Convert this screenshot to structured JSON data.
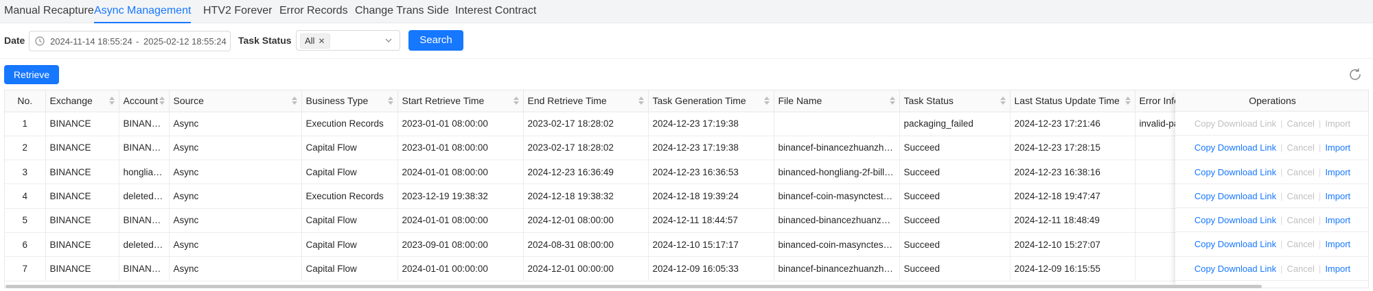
{
  "tabs": [
    {
      "label": "Manual Recapture"
    },
    {
      "label": "Async Management"
    },
    {
      "label": "HTV2 Forever"
    },
    {
      "label": "Error Records"
    },
    {
      "label": "Change Trans Side"
    },
    {
      "label": "Interest Contract"
    }
  ],
  "active_tab": "Async Management",
  "filters": {
    "date_label": "Date",
    "date_start": "2024-11-14 18:55:24",
    "date_sep": "-",
    "date_end": "2025-02-12 18:55:24",
    "task_status_label": "Task Status",
    "task_status_tag": "All",
    "search_label": "Search"
  },
  "toolbar": {
    "retrieve_label": "Retrieve"
  },
  "table": {
    "columns": [
      "No.",
      "Exchange",
      "Account",
      "Source",
      "Business Type",
      "Start Retrieve Time",
      "End Retrieve Time",
      "Task Generation Time",
      "File Name",
      "Task Status",
      "Last Status Update Time",
      "Error Info",
      "Operations"
    ],
    "rows": [
      {
        "no": "1",
        "exchange": "BINANCE",
        "account": "BINANC...",
        "source": "Async",
        "business_type": "Execution Records",
        "start": "2023-01-01 08:00:00",
        "end": "2023-02-17 18:28:02",
        "generated": "2024-12-23 17:19:38",
        "file": "",
        "status": "packaging_failed",
        "updated": "2024-12-23 17:21:46",
        "error": "invalid-pa",
        "ops_disabled": true
      },
      {
        "no": "2",
        "exchange": "BINANCE",
        "account": "BINANC...",
        "source": "Async",
        "business_type": "Capital Flow",
        "start": "2023-01-01 08:00:00",
        "end": "2023-02-17 18:28:02",
        "generated": "2024-12-23 17:19:38",
        "file": "binancef-binancezhuanzhan...",
        "status": "Succeed",
        "updated": "2024-12-23 17:28:15",
        "error": "",
        "ops_disabled": false
      },
      {
        "no": "3",
        "exchange": "BINANCE",
        "account": "honglian...",
        "source": "Async",
        "business_type": "Capital Flow",
        "start": "2024-01-01 08:00:00",
        "end": "2024-12-23 16:36:49",
        "generated": "2024-12-23 16:36:53",
        "file": "binanced-hongliang-2f-bill-2...",
        "status": "Succeed",
        "updated": "2024-12-23 16:38:16",
        "error": "",
        "ops_disabled": false
      },
      {
        "no": "4",
        "exchange": "BINANCE",
        "account": "deleted--...",
        "source": "Async",
        "business_type": "Execution Records",
        "start": "2023-12-19 19:38:32",
        "end": "2024-12-18 19:38:32",
        "generated": "2024-12-18 19:39:24",
        "file": "binancef-coin-masynctest-0...",
        "status": "Succeed",
        "updated": "2024-12-18 19:47:47",
        "error": "",
        "ops_disabled": false
      },
      {
        "no": "5",
        "exchange": "BINANCE",
        "account": "BINANC...",
        "source": "Async",
        "business_type": "Capital Flow",
        "start": "2024-01-01 08:00:00",
        "end": "2024-12-01 08:00:00",
        "generated": "2024-12-11 18:44:57",
        "file": "binanced-binancezhuanzha...",
        "status": "Succeed",
        "updated": "2024-12-11 18:48:49",
        "error": "",
        "ops_disabled": false
      },
      {
        "no": "6",
        "exchange": "BINANCE",
        "account": "deleted--...",
        "source": "Async",
        "business_type": "Capital Flow",
        "start": "2023-09-01 08:00:00",
        "end": "2024-08-31 08:00:00",
        "generated": "2024-12-10 15:17:17",
        "file": "binanced-coin-masynctest-0...",
        "status": "Succeed",
        "updated": "2024-12-10 15:27:07",
        "error": "",
        "ops_disabled": false
      },
      {
        "no": "7",
        "exchange": "BINANCE",
        "account": "BINANC...",
        "source": "Async",
        "business_type": "Capital Flow",
        "start": "2024-01-01 00:00:00",
        "end": "2024-12-01 00:00:00",
        "generated": "2024-12-09 16:05:33",
        "file": "binancef-binancezhuanzhan...",
        "status": "Succeed",
        "updated": "2024-12-09 16:15:55",
        "error": "",
        "ops_disabled": false
      }
    ],
    "ops": {
      "copy": "Copy Download Link",
      "cancel": "Cancel",
      "import": "Import",
      "sep": "|"
    }
  },
  "colors": {
    "accent": "#1677ff",
    "disabled": "#bfbfbf"
  }
}
